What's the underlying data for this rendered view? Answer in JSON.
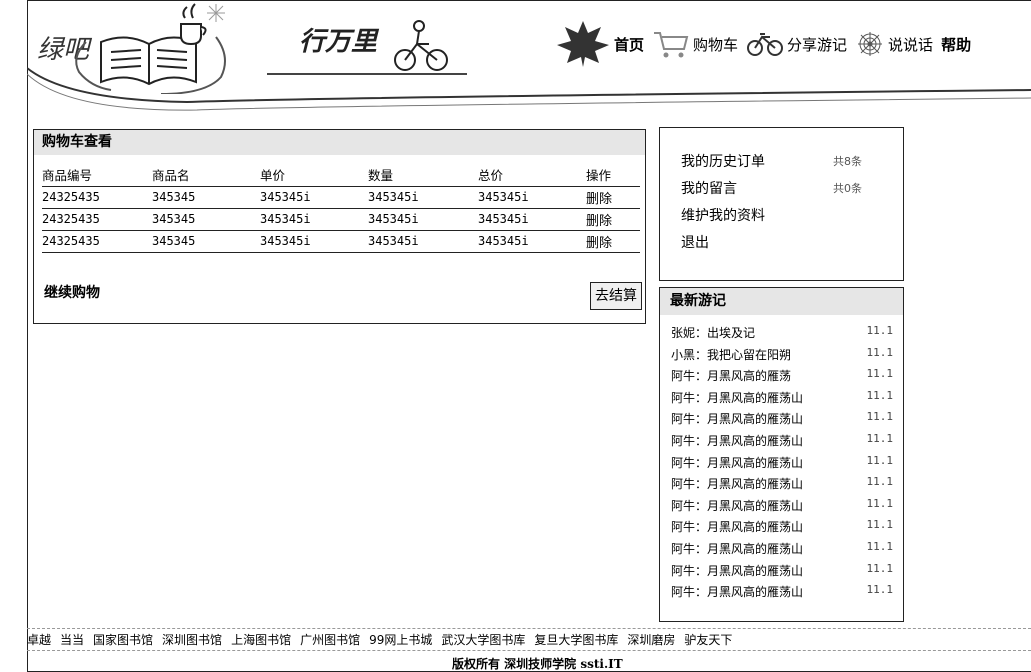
{
  "header": {
    "logo_text": "绿吧",
    "slogan_text": "行万里",
    "nav": [
      {
        "label": "首页",
        "icon": "maple-leaf-icon",
        "bold": true
      },
      {
        "label": "购物车",
        "icon": "shopping-cart-icon",
        "bold": false
      },
      {
        "label": "分享游记",
        "icon": "bicycle-icon",
        "bold": false
      },
      {
        "label": "说说话",
        "icon": "spider-web-icon",
        "bold": false
      },
      {
        "label": "帮助",
        "icon": "",
        "bold": true
      }
    ]
  },
  "cart": {
    "title": "购物车查看",
    "columns": [
      "商品编号",
      "商品名",
      "单价",
      "数量",
      "总价",
      "操作"
    ],
    "rows": [
      [
        "24325435",
        "345345",
        "345345i",
        "345345i",
        "345345i",
        "删除"
      ],
      [
        "24325435",
        "345345",
        "345345i",
        "345345i",
        "345345i",
        "删除"
      ],
      [
        "24325435",
        "345345",
        "345345i",
        "345345i",
        "345345i",
        "删除"
      ]
    ],
    "continue_label": "继续购物",
    "checkout_label": "去结算"
  },
  "user": {
    "items": [
      {
        "label": "我的历史订单",
        "count": "共8条"
      },
      {
        "label": "我的留言",
        "count": "共0条"
      },
      {
        "label": "维护我的资料",
        "count": ""
      },
      {
        "label": "退出",
        "count": ""
      }
    ]
  },
  "travel": {
    "title": "最新游记",
    "items": [
      {
        "title": "张妮：出埃及记",
        "date": "11.1"
      },
      {
        "title": "小黑：我把心留在阳朔",
        "date": "11.1"
      },
      {
        "title": "阿牛：月黑风高的雁荡",
        "date": "11.1"
      },
      {
        "title": "阿牛：月黑风高的雁荡山",
        "date": "11.1"
      },
      {
        "title": "阿牛：月黑风高的雁荡山",
        "date": "11.1"
      },
      {
        "title": "阿牛：月黑风高的雁荡山",
        "date": "11.1"
      },
      {
        "title": "阿牛：月黑风高的雁荡山",
        "date": "11.1"
      },
      {
        "title": "阿牛：月黑风高的雁荡山",
        "date": "11.1"
      },
      {
        "title": "阿牛：月黑风高的雁荡山",
        "date": "11.1"
      },
      {
        "title": "阿牛：月黑风高的雁荡山",
        "date": "11.1"
      },
      {
        "title": "阿牛：月黑风高的雁荡山",
        "date": "11.1"
      },
      {
        "title": "阿牛：月黑风高的雁荡山",
        "date": "11.1"
      },
      {
        "title": "阿牛：月黑风高的雁荡山",
        "date": "11.1"
      }
    ]
  },
  "footer": {
    "links": [
      "卓越",
      "当当",
      "国家图书馆",
      "深圳图书馆",
      "上海图书馆",
      "广州图书馆",
      "99网上书城",
      "武汉大学图书库",
      "复旦大学图书库",
      "深圳磨房",
      "驴友天下"
    ],
    "copyright": "版权所有 深圳技师学院 ssti.IT"
  }
}
